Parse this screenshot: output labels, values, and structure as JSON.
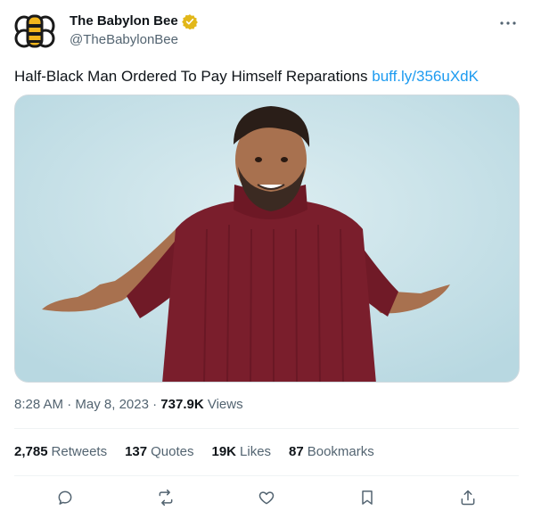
{
  "author": {
    "display_name": "The Babylon Bee",
    "handle": "@TheBabylonBee",
    "verified_color": "#e2b719",
    "logo_icon": "bee-logo-icon"
  },
  "tweet": {
    "text": "Half-Black Man Ordered To Pay Himself Reparations ",
    "link_text": "buff.ly/356uXdK",
    "link_color": "#1d9bf0"
  },
  "meta": {
    "time": "8:28 AM",
    "separator": " · ",
    "date": "May 8, 2023",
    "views_count": "737.9K",
    "views_label": " Views"
  },
  "stats": {
    "retweets_count": "2,785",
    "retweets_label": "Retweets",
    "quotes_count": "137",
    "quotes_label": "Quotes",
    "likes_count": "19K",
    "likes_label": "Likes",
    "bookmarks_count": "87",
    "bookmarks_label": "Bookmarks"
  },
  "actions": [
    "reply-icon",
    "retweet-icon",
    "like-icon",
    "bookmark-icon",
    "share-icon"
  ],
  "colors": {
    "text": "#0f1419",
    "secondary": "#536471",
    "divider": "#eff3f4",
    "media_background": "#c9e3ea",
    "sweater": "#7a1e2c"
  }
}
